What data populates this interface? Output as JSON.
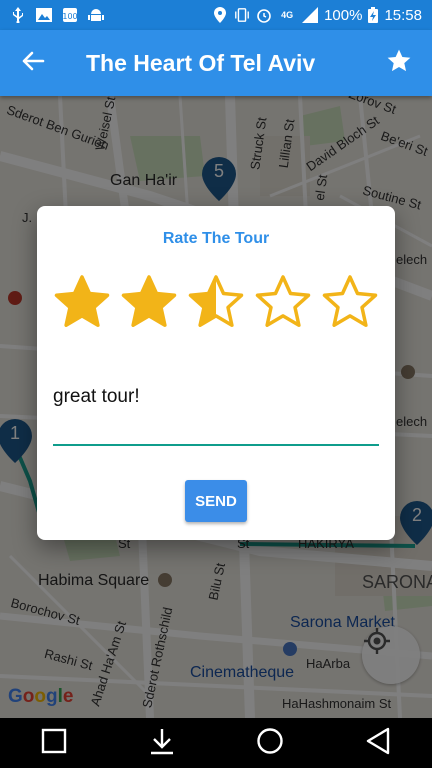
{
  "status_bar": {
    "battery": "100%",
    "time": "15:58",
    "network": "4G",
    "left_icons": [
      "usb-icon",
      "image-icon",
      "speed-icon",
      "android-icon"
    ],
    "right_icons": [
      "location-icon",
      "vibrate-icon",
      "alarm-icon",
      "signal-icon",
      "battery-icon"
    ]
  },
  "app_bar": {
    "title": "The Heart Of Tel Aviv",
    "back_icon": "arrow-left-icon",
    "favorite_icon": "star-icon"
  },
  "map": {
    "labels": {
      "sderot_ben_gurion": "Sderot Ben Gurion",
      "weisel": "Weisel St",
      "gan_hair": "Gan Ha'ir",
      "struck": "Struck St",
      "lillian": "Lillian St",
      "david_bloch": "David Bloch St",
      "zorov": "Zorov St",
      "beeri": "Be'eri St",
      "tel_st": "el St",
      "soutine": "Soutine St",
      "elech1": "elech",
      "elech2": "elech",
      "habima": "Habima Square",
      "borochov": "Borochov St",
      "rashi": "Rashi St",
      "ahad_haam": "Ahad Ha'Am St",
      "rothschild": "Sderot Rothschild",
      "bilu": "Bilu St",
      "sarona_market": "Sarona Market",
      "sarona": "SARONA",
      "haarba": "HaArba",
      "cinematheque": "Cinematheque",
      "hahashmonaim": "HaHashmonaim St",
      "st1": "St",
      "st2": "St",
      "hakirya": "HAKIRYA",
      "j": "J."
    },
    "pins": [
      "5",
      "1",
      "2"
    ],
    "attribution": "Google"
  },
  "dialog": {
    "title": "Rate The Tour",
    "rating": 2.5,
    "max_rating": 5,
    "star_color": "#f2b418",
    "comment_value": "great tour!",
    "send_label": "SEND"
  },
  "nav_bar": {
    "icons": [
      "recent-apps-icon",
      "download-icon",
      "home-icon",
      "back-icon"
    ]
  }
}
